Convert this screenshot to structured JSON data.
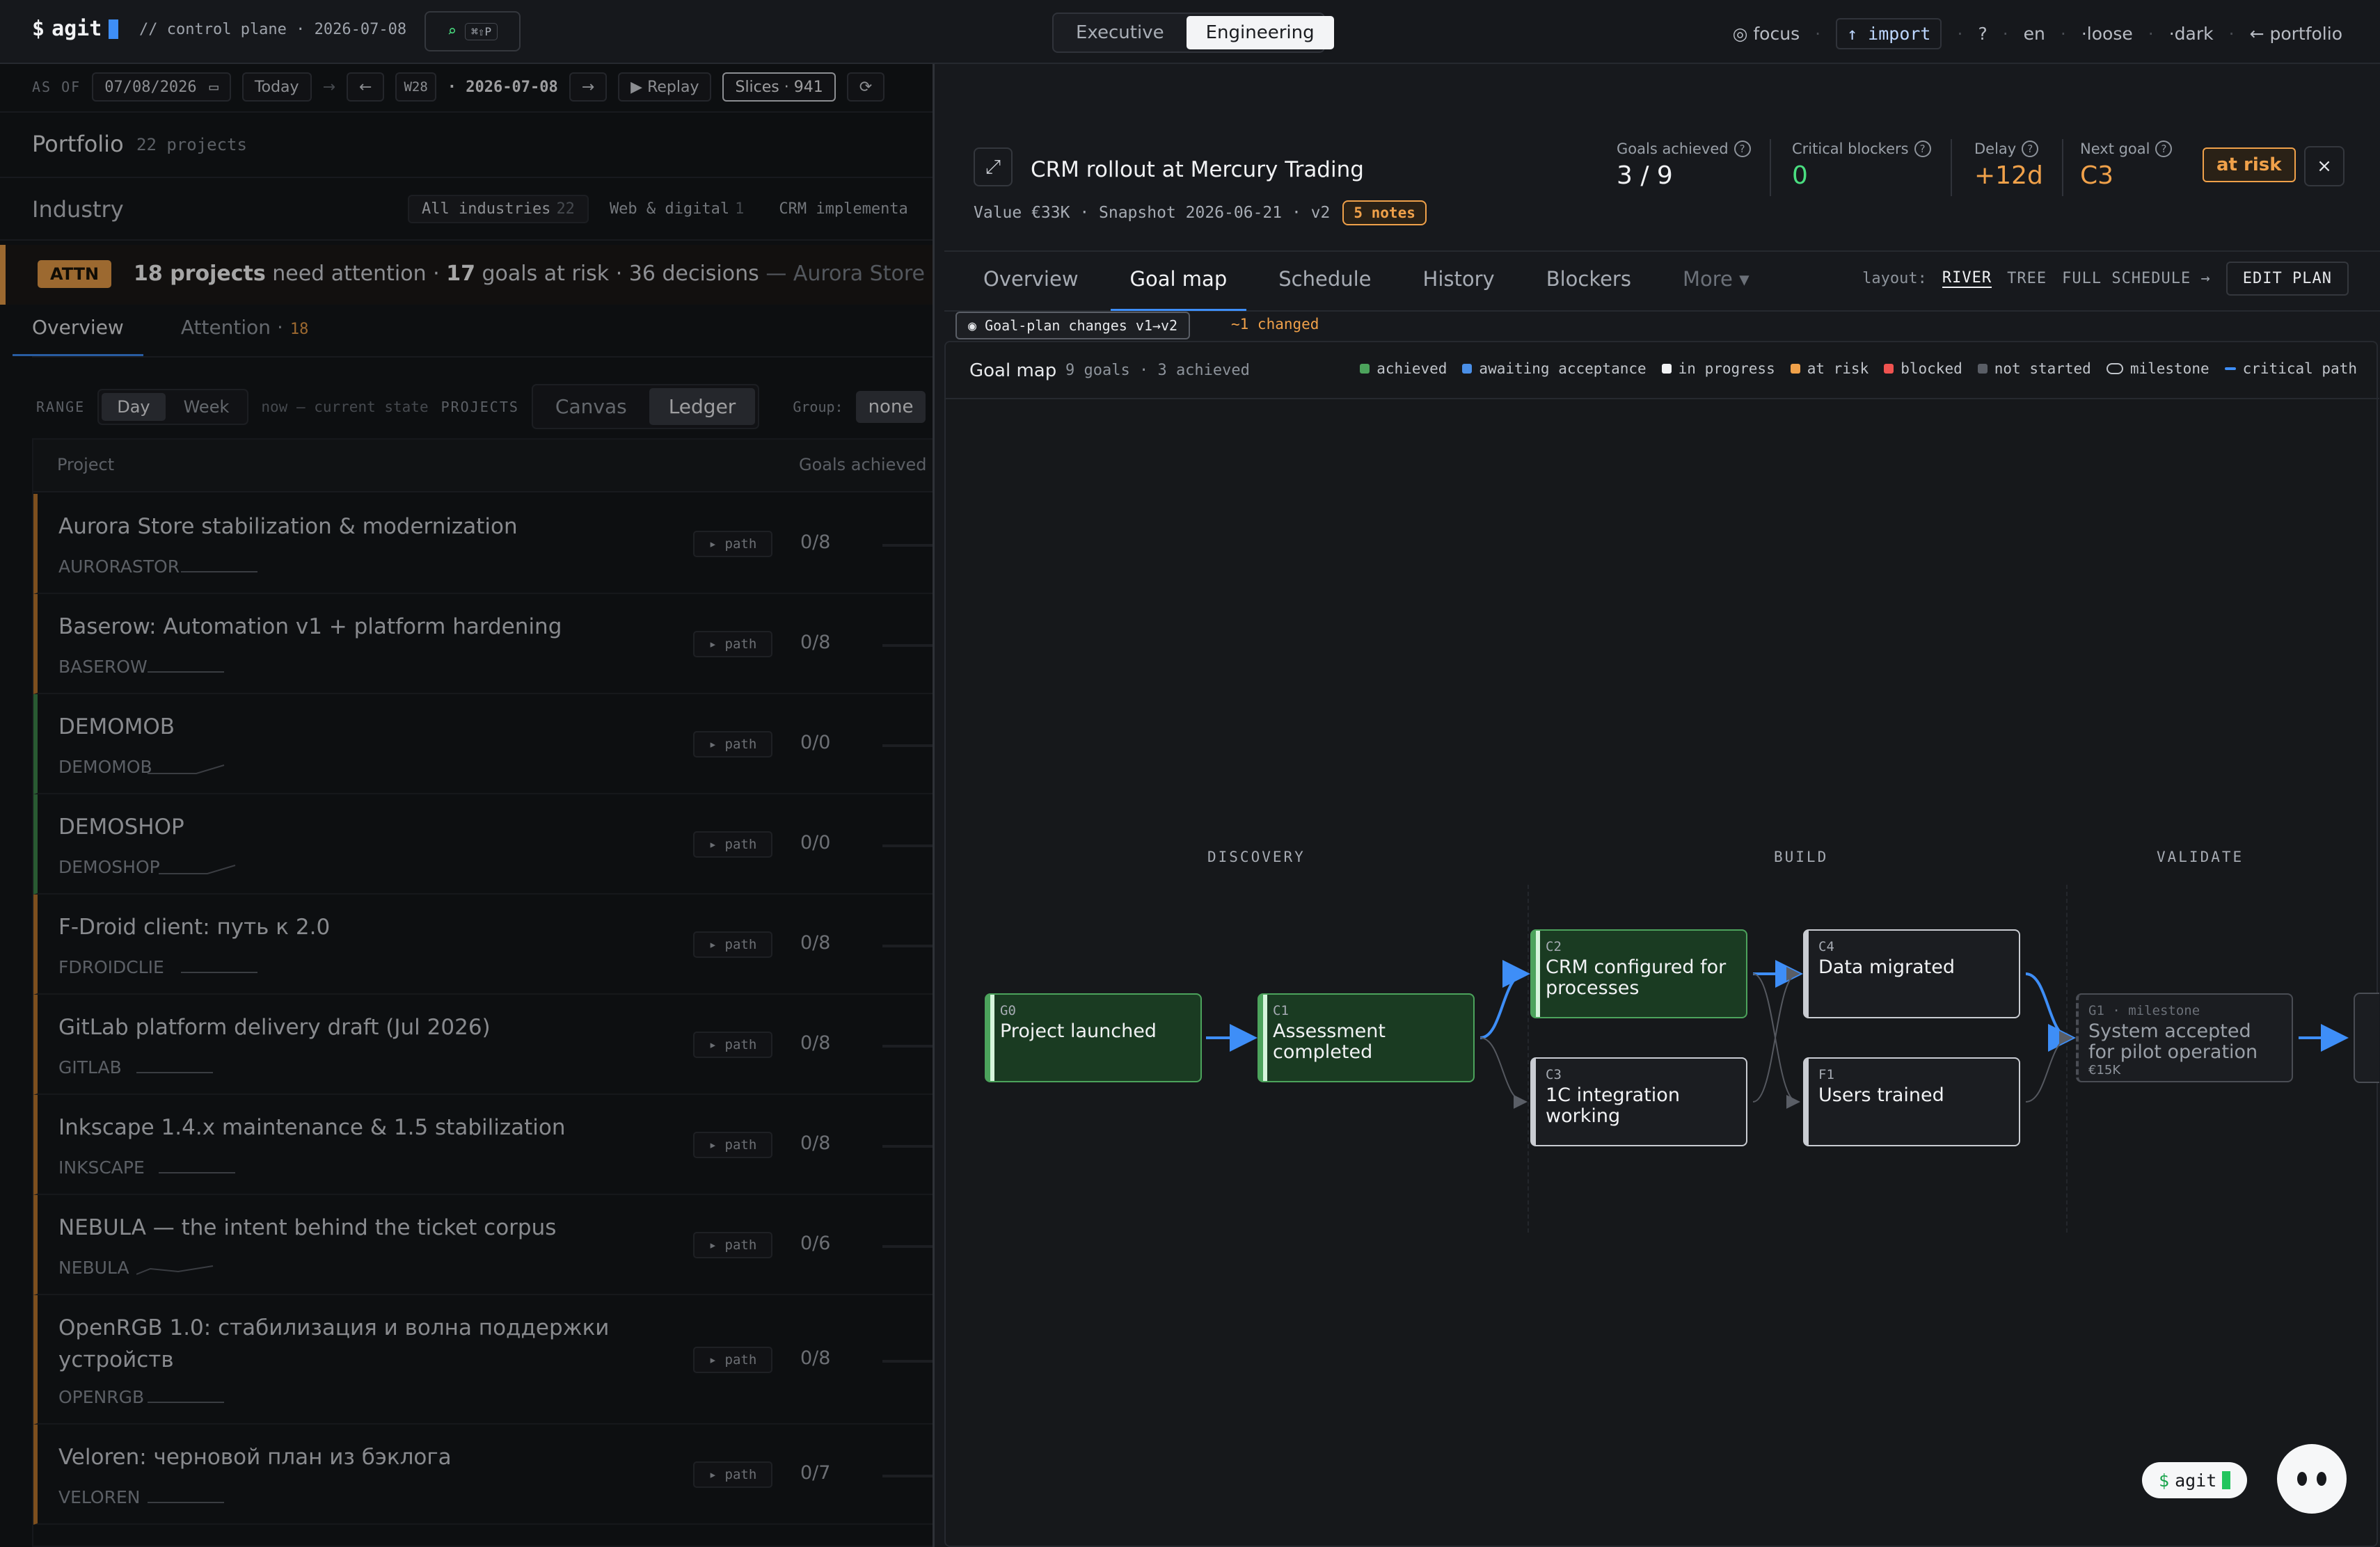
{
  "brand": {
    "prompt": "$",
    "name": "agit"
  },
  "topbar": {
    "subtitle": "// control plane · 2026-07-08",
    "cmdk_kbd": "⌘⇧P",
    "views": [
      "Executive",
      "Engineering"
    ],
    "active_view": "Engineering",
    "right": {
      "focus": "◎ focus",
      "import": "↑ import",
      "help": "?",
      "lang": "en",
      "mode": "·loose",
      "theme": "·dark",
      "portfolio": "← portfolio"
    }
  },
  "asof": {
    "label": "AS OF",
    "date_value": "07/08/2026",
    "today": "Today",
    "arrow": "→",
    "prev": "←",
    "week": "W28",
    "current_date": "· 2026-07-08",
    "next": "→",
    "replay": "▶ Replay",
    "slices": "Slices · 941",
    "refresh": "⟳"
  },
  "portfolio": {
    "title": "Portfolio",
    "count": "22 projects",
    "industry_label": "Industry",
    "chips": [
      {
        "label": "All industries",
        "count": "22",
        "active": true
      },
      {
        "label": "Web & digital",
        "count": "1",
        "active": false
      },
      {
        "label": "CRM implementa",
        "count": "",
        "active": false
      }
    ],
    "attention": {
      "badge": "ATTN",
      "projects_num": "18 projects",
      "projects_text": "need attention ·",
      "goals_num": "17",
      "goals_text": "goals at risk · 36 decisions",
      "tail": "— Aurora Store stabilizati"
    },
    "tabs": [
      {
        "label": "Overview",
        "count": ""
      },
      {
        "label": "Attention ·",
        "count": "18"
      }
    ],
    "range_label": "RANGE",
    "range_options": [
      "Day",
      "Week"
    ],
    "range_hint": "now — current state",
    "projects_label": "PROJECTS",
    "projects_options": [
      "Canvas",
      "Ledger"
    ],
    "group_label": "Group:",
    "group_value": "none",
    "table_headers": {
      "project": "Project",
      "goals": "Goals achieved"
    },
    "path_label": "▸ path",
    "rows": [
      {
        "name": "Aurora Store stabilization & modernization",
        "code": "AURORASTOR",
        "goals": "0/8",
        "status": "warn"
      },
      {
        "name": "Baserow: Automation v1 + platform hardening",
        "code": "BASEROW",
        "goals": "0/8",
        "status": "warn"
      },
      {
        "name": "DEMOMOB",
        "code": "DEMOMOB",
        "goals": "0/0",
        "status": "ok"
      },
      {
        "name": "DEMOSHOP",
        "code": "DEMOSHOP",
        "goals": "0/0",
        "status": "ok"
      },
      {
        "name": "F-Droid client: путь к 2.0",
        "code": "FDROIDCLIE",
        "goals": "0/8",
        "status": "warn"
      },
      {
        "name": "GitLab platform delivery draft (Jul 2026)",
        "code": "GITLAB",
        "goals": "0/8",
        "status": "warn"
      },
      {
        "name": "Inkscape 1.4.x maintenance & 1.5 stabilization",
        "code": "INKSCAPE",
        "goals": "0/8",
        "status": "warn"
      },
      {
        "name": "NEBULA — the intent behind the ticket corpus",
        "code": "NEBULA",
        "goals": "0/6",
        "status": "warn"
      },
      {
        "name": "OpenRGB 1.0: стабилизация и волна поддержки устройств",
        "code": "OPENRGB",
        "goals": "0/8",
        "status": "warn"
      },
      {
        "name": "Veloren: черновой план из бэклога",
        "code": "VELOREN",
        "goals": "0/7",
        "status": "warn"
      }
    ]
  },
  "drawer": {
    "title": "CRM rollout at Mercury Trading",
    "meta": "Value €33K · Snapshot 2026-06-21 · v2",
    "notes": "5 notes",
    "kpis": [
      {
        "label": "Goals achieved",
        "value": "3 / 9",
        "color": "#f1f2f4"
      },
      {
        "label": "Critical blockers",
        "value": "0",
        "color": "#4ade80"
      },
      {
        "label": "Delay",
        "value": "+12d",
        "color": "#f0a14a"
      },
      {
        "label": "Next goal",
        "value": "C3",
        "color": "#f0a14a"
      }
    ],
    "risk": "at risk",
    "close": "×",
    "tabs": [
      "Overview",
      "Goal map",
      "Schedule",
      "History",
      "Blockers",
      "More ▾"
    ],
    "active_tab": "Goal map",
    "layout_label": "layout:",
    "layout_options": [
      "RIVER",
      "TREE"
    ],
    "active_layout": "RIVER",
    "full_schedule": "FULL SCHEDULE →",
    "edit_plan": "EDIT PLAN",
    "changes_chip": "◉ Goal-plan changes v1→v2",
    "changes_diff": "~1 changed",
    "map": {
      "title": "Goal map",
      "subtitle": "9 goals · 3 achieved",
      "legend": [
        {
          "label": "achieved",
          "color": "#4ca35c"
        },
        {
          "label": "awaiting acceptance",
          "color": "#4a8fe7"
        },
        {
          "label": "in progress",
          "color": "#f1f2f4"
        },
        {
          "label": "at risk",
          "color": "#f0a14a"
        },
        {
          "label": "blocked",
          "color": "#ef5350"
        },
        {
          "label": "not started",
          "color": "#5a5e66"
        },
        {
          "label": "milestone",
          "color": ""
        },
        {
          "label": "critical path",
          "color": "#3e8ef7"
        }
      ],
      "phases": [
        "DISCOVERY",
        "BUILD",
        "VALIDATE"
      ],
      "nodes": [
        {
          "id": "G0",
          "title": "Project launched",
          "state": "achieved"
        },
        {
          "id": "C1",
          "title": "Assessment completed",
          "state": "achieved"
        },
        {
          "id": "C2",
          "title": "CRM configured for processes",
          "state": "achieved"
        },
        {
          "id": "C3",
          "title": "1C integration working",
          "state": "in-progress"
        },
        {
          "id": "C4",
          "title": "Data migrated",
          "state": "in-progress"
        },
        {
          "id": "F1",
          "title": "Users trained",
          "state": "in-progress"
        },
        {
          "id": "G1 · milestone",
          "title": "System accepted for pilot operation",
          "value": "€15K",
          "state": "not-started"
        }
      ]
    }
  },
  "assistant": {
    "prompt": "$",
    "name": "agit"
  }
}
